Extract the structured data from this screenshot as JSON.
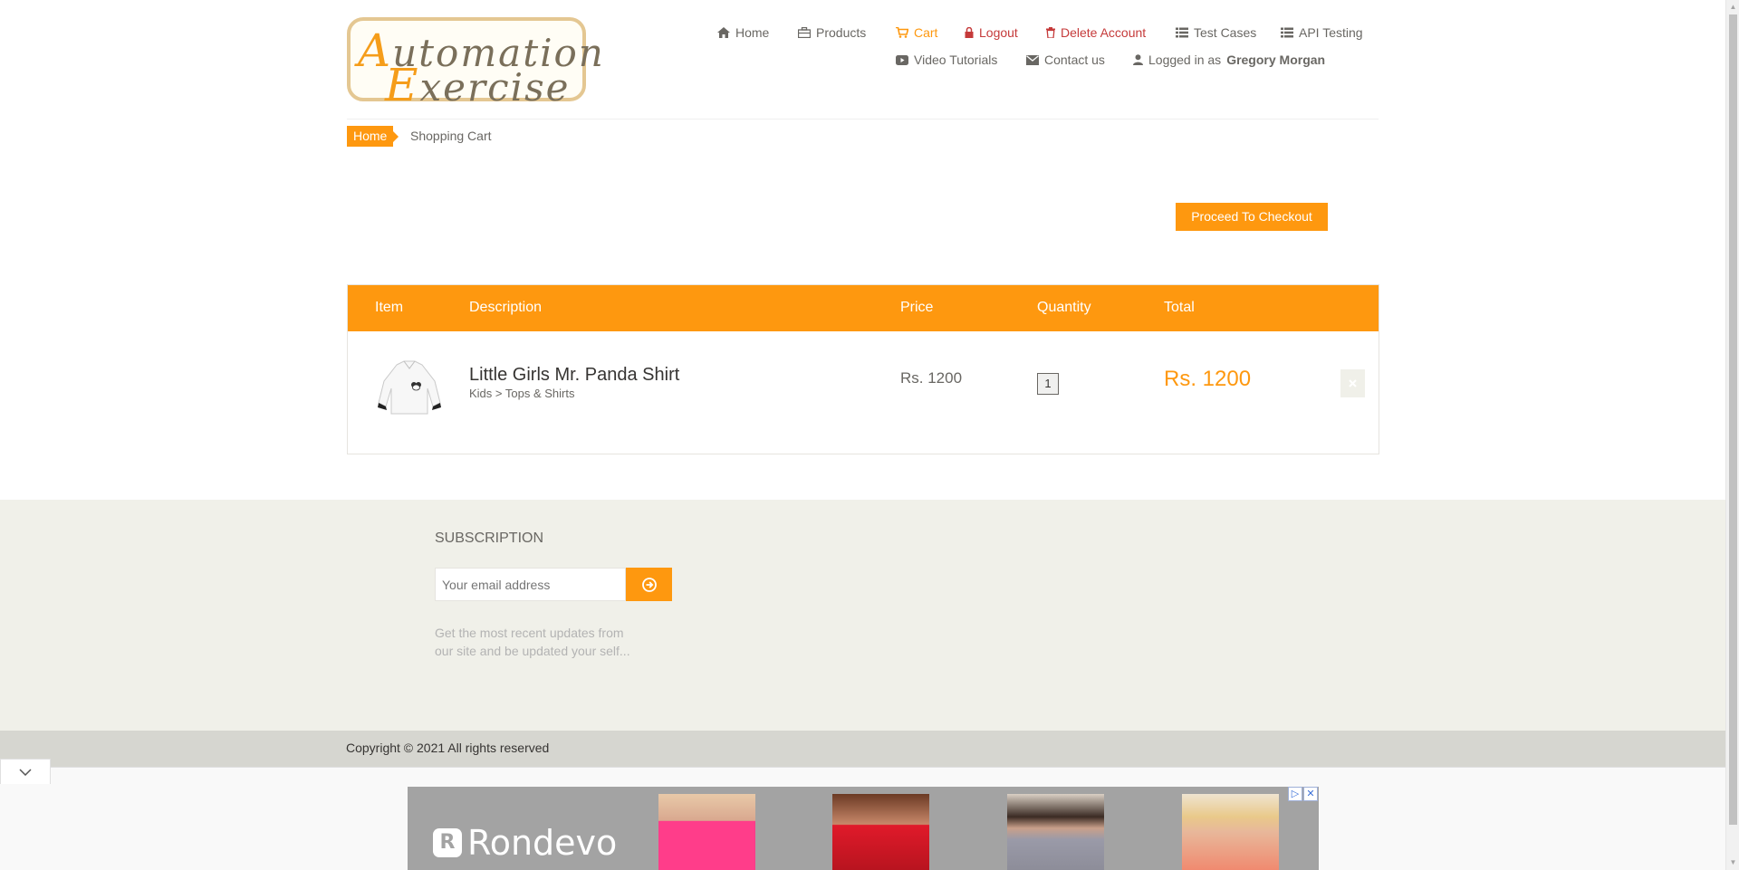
{
  "logo": {
    "line1_cap": "A",
    "line1_rest": "utomation",
    "line2_cap": "E",
    "line2_rest": "xercise"
  },
  "nav": {
    "home": "Home",
    "products": "Products",
    "cart": "Cart",
    "logout": "Logout",
    "delete_account": "Delete Account",
    "test_cases": "Test Cases",
    "api_testing": "API Testing",
    "video_tutorials": "Video Tutorials",
    "contact_us": "Contact us",
    "logged_in_prefix": "Logged in as",
    "logged_in_user": "Gregory Morgan"
  },
  "breadcrumb": {
    "home": "Home",
    "current": "Shopping Cart"
  },
  "checkout": {
    "label": "Proceed To Checkout"
  },
  "cart": {
    "headers": {
      "item": "Item",
      "description": "Description",
      "price": "Price",
      "quantity": "Quantity",
      "total": "Total"
    },
    "rows": [
      {
        "name": "Little Girls Mr. Panda Shirt",
        "category": "Kids > Tops & Shirts",
        "price": "Rs. 1200",
        "quantity": "1",
        "total": "Rs. 1200",
        "image_icon": "shirt-product-image"
      }
    ]
  },
  "subscription": {
    "title": "SUBSCRIPTION",
    "placeholder": "Your email address",
    "text": "Get the most recent updates from our site and be updated your self..."
  },
  "footer": {
    "copyright": "Copyright © 2021 All rights reserved"
  },
  "ad": {
    "brand": "Rondevo",
    "brand_mark": "R"
  },
  "colors": {
    "accent": "#fe980f",
    "danger": "#c53a3a",
    "footer_bg": "#f0f0e9",
    "footer_bottom_bg": "#d6d6d0",
    "text": "#696763"
  }
}
